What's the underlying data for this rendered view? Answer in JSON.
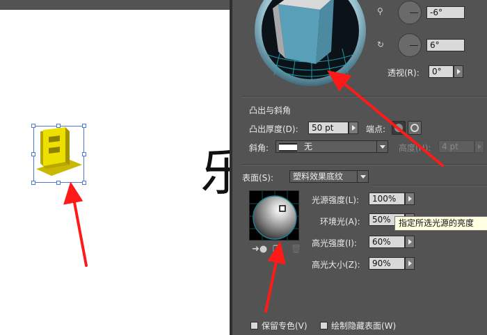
{
  "canvas": {
    "background_glyph": "乐",
    "selected_object": "3d-extruded-letter"
  },
  "panel": {
    "rotation": {
      "vertical_value": "-6°",
      "horizontal_value": "6°",
      "perspective_label": "透视(R):",
      "perspective_value": "0°"
    },
    "extrude_bevel": {
      "section_title": "凸出与斜角",
      "depth_label": "凸出厚度(D):",
      "depth_value": "50 pt",
      "cap_label": "端点:",
      "bevel_label": "斜角:",
      "bevel_value": "无",
      "height_label": "高度(H):",
      "height_value": "4 pt"
    },
    "surface": {
      "label": "表面(S):",
      "value": "塑料效果底纹",
      "light_intensity_label": "光源强度(L):",
      "light_intensity_value": "100%",
      "ambient_label": "环境光(A):",
      "ambient_value": "50%",
      "highlight_intensity_label": "高光强度(I):",
      "highlight_intensity_value": "60%",
      "highlight_size_label": "高光大小(Z):",
      "highlight_size_value": "90%"
    },
    "tooltip": "指定所选光源的亮度",
    "options": {
      "preserve_spot_label": "保留专色(V)",
      "draw_hidden_label": "绘制隐藏表面(W)"
    }
  },
  "colors": {
    "panel_bg": "#535353",
    "cube_front": "#5a9fb8",
    "letter_yellow": "#e6d200",
    "arrow_red": "#ff1a1a"
  }
}
